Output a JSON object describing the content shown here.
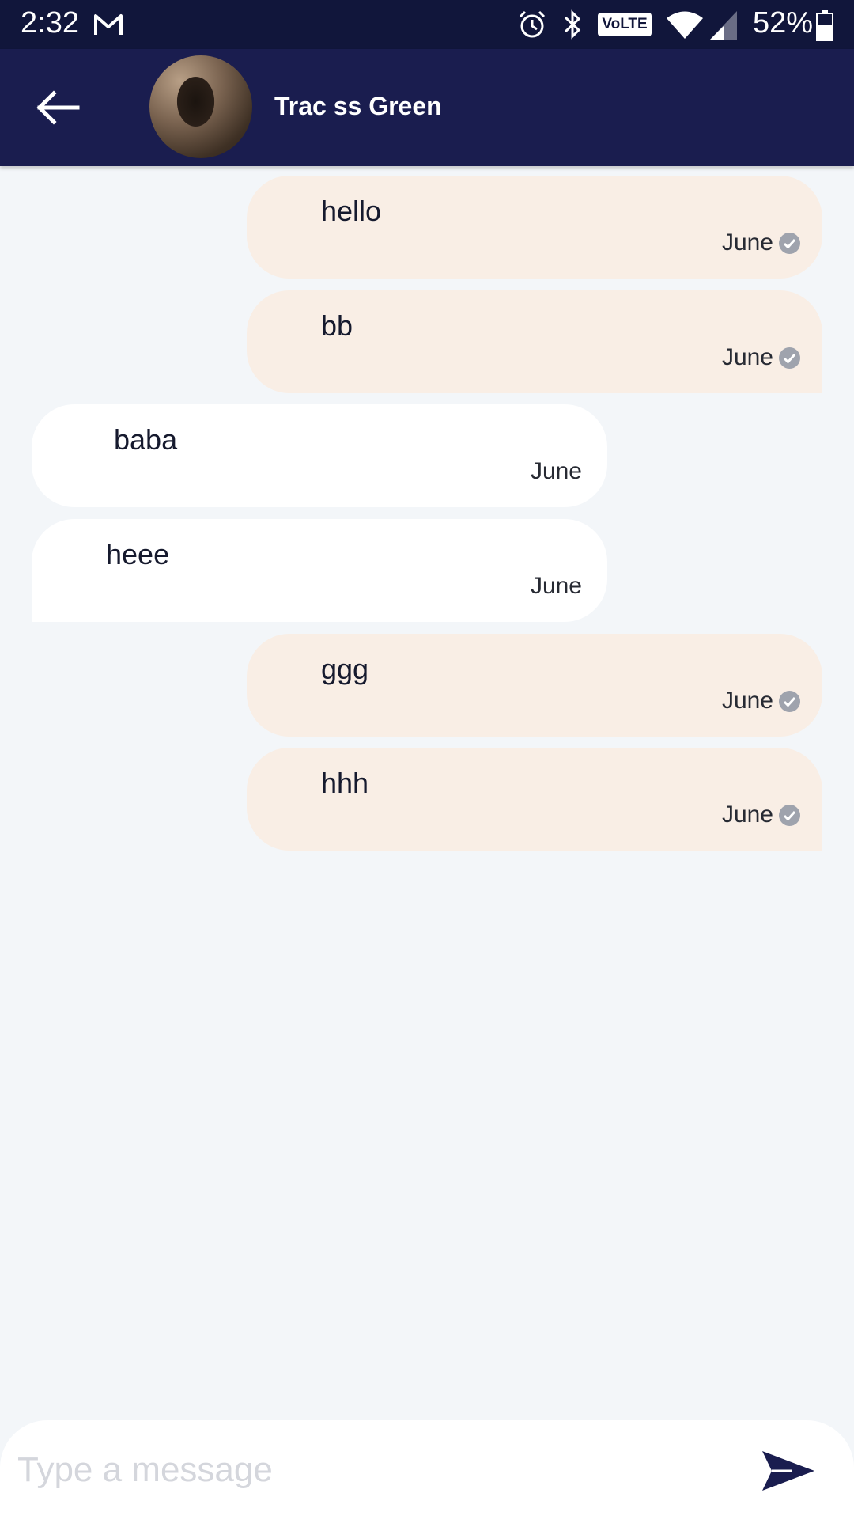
{
  "status_bar": {
    "time": "2:32",
    "volte_label": "VoLTE",
    "battery_percent": "52%",
    "icons": [
      "gmail-icon",
      "alarm-icon",
      "bluetooth-icon",
      "volte-icon",
      "wifi-icon",
      "signal-icon",
      "battery-icon"
    ]
  },
  "header": {
    "contact_name": "Trac ss Green",
    "icons": [
      "back-arrow-icon",
      "avatar"
    ]
  },
  "messages": [
    {
      "text": "hello",
      "time": "June",
      "direction": "outgoing",
      "read": true
    },
    {
      "text": "bb",
      "time": "June",
      "direction": "outgoing",
      "read": true
    },
    {
      "text": "baba",
      "time": "June",
      "direction": "incoming",
      "read": false
    },
    {
      "text": "heee",
      "time": "June",
      "direction": "incoming",
      "read": false
    },
    {
      "text": "ggg",
      "time": "June",
      "direction": "outgoing",
      "read": true
    },
    {
      "text": "hhh",
      "time": "June",
      "direction": "outgoing",
      "read": true
    }
  ],
  "composer": {
    "placeholder": "Type a message",
    "value": "",
    "send_icon": "send-icon"
  },
  "colors": {
    "status_bar": "#11163b",
    "app_bar": "#1a1d4f",
    "background": "#f3f6f9",
    "outgoing_bubble": "#f9eee5",
    "incoming_bubble": "#ffffff",
    "read_check": "#9fa3ad"
  }
}
